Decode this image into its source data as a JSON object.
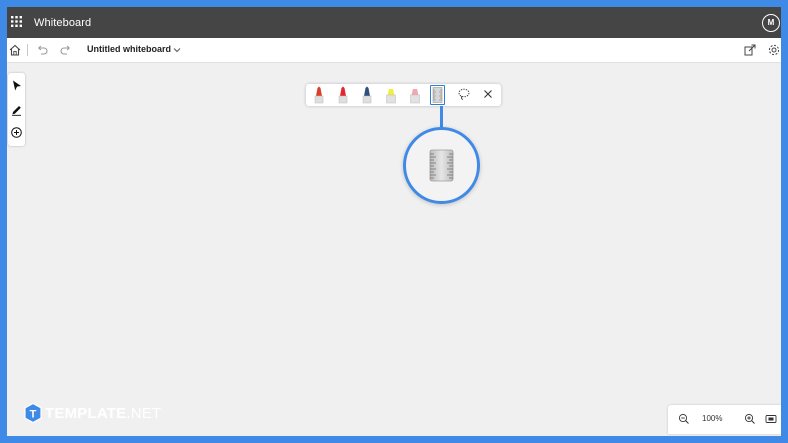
{
  "app": {
    "title": "Whiteboard",
    "avatar_initial": "M"
  },
  "document": {
    "title": "Untitled whiteboard"
  },
  "colors": {
    "accent": "#3f8ae6",
    "titlebar": "#454545",
    "canvas": "#f0f0f0",
    "pen_red": "#d9402b",
    "pen_crimson": "#e0262f",
    "pen_navy": "#2f4e7a",
    "highlighter_yellow": "#f0ef3e",
    "highlighter_pink": "#f1a6b3"
  },
  "ink_toolbar": {
    "tools": [
      {
        "icon": "pen-red-icon"
      },
      {
        "icon": "pen-crimson-icon"
      },
      {
        "icon": "pen-navy-icon"
      },
      {
        "icon": "highlighter-yellow-icon"
      },
      {
        "icon": "highlighter-pink-icon"
      },
      {
        "icon": "ruler-icon",
        "selected": true
      },
      {
        "icon": "lasso-select-icon"
      },
      {
        "icon": "close-icon"
      }
    ]
  },
  "left_toolbar": {
    "tools": [
      "select-arrow-icon",
      "pen-icon",
      "add-icon"
    ]
  },
  "zoom": {
    "level": "100%"
  },
  "branding": {
    "logo_letter": "T",
    "name_bold": "TEMPLATE",
    "name_suffix": ".NET"
  }
}
